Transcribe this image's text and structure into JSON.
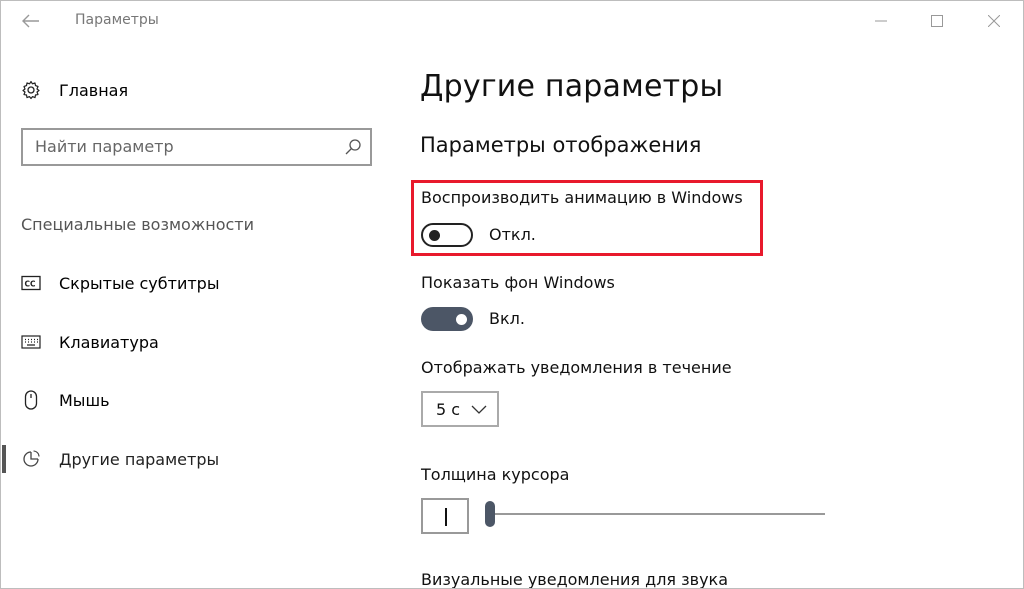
{
  "window": {
    "title": "Параметры"
  },
  "icons": {
    "back": "back-arrow-icon",
    "home": "gear-icon",
    "search": "search-icon",
    "captions": "closed-captions-icon",
    "keyboard": "keyboard-icon",
    "mouse": "mouse-icon",
    "other": "other-options-icon"
  },
  "sidebar": {
    "home_label": "Главная",
    "search_placeholder": "Найти параметр",
    "section_label": "Специальные возможности",
    "items": [
      {
        "label": "Скрытые субтитры",
        "icon": "closed-captions-icon",
        "active": false
      },
      {
        "label": "Клавиатура",
        "icon": "keyboard-icon",
        "active": false
      },
      {
        "label": "Мышь",
        "icon": "mouse-icon",
        "active": false
      },
      {
        "label": "Другие параметры",
        "icon": "other-options-icon",
        "active": true
      }
    ]
  },
  "main": {
    "title": "Другие параметры",
    "subtitle": "Параметры отображения",
    "animation": {
      "label": "Воспроизводить анимацию в Windows",
      "state_label": "Откл.",
      "on": false
    },
    "background": {
      "label": "Показать фон Windows",
      "state_label": "Вкл.",
      "on": true
    },
    "notifications": {
      "label": "Отображать уведомления в течение",
      "value": "5 с"
    },
    "cursor": {
      "label": "Толщина курсора",
      "value_fraction": 0.0
    },
    "visual_notifications": {
      "label": "Визуальные уведомления для звука"
    }
  },
  "colors": {
    "highlight": "#e8192c",
    "toggle_on": "#4c5666",
    "text": "#111111",
    "muted": "#777777"
  }
}
